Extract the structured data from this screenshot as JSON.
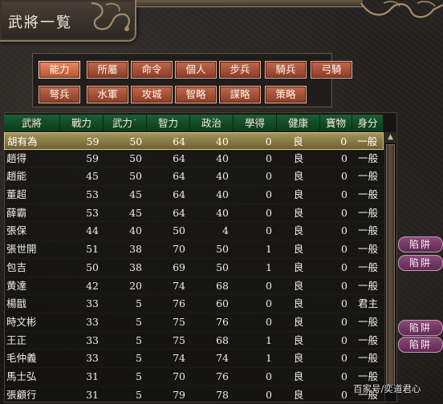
{
  "window": {
    "title": "武將一覧"
  },
  "category_buttons": [
    {
      "label": "能力",
      "active": true
    },
    {
      "label": "所屬",
      "active": false
    },
    {
      "label": "命令",
      "active": false
    },
    {
      "label": "個人",
      "active": false
    },
    {
      "label": "步兵",
      "active": false
    },
    {
      "label": "騎兵",
      "active": false
    },
    {
      "label": "弓騎",
      "active": false
    },
    {
      "label": "弩兵",
      "active": false
    },
    {
      "label": "水軍",
      "active": false
    },
    {
      "label": "攻城",
      "active": false
    },
    {
      "label": "智略",
      "active": false
    },
    {
      "label": "謀略",
      "active": false
    },
    {
      "label": "策略",
      "active": false
    }
  ],
  "table": {
    "headers": [
      "武將",
      "戰力",
      "武力",
      "智力",
      "政治",
      "學得",
      "健康",
      "寶物",
      "身分"
    ],
    "sorted_column": "武力",
    "rows": [
      {
        "name": "胡有為",
        "zhanli": "59",
        "wuli": "50",
        "zhili": "64",
        "zhengzhi": "40",
        "xuede": "0",
        "jiankang": "良",
        "baowu": "0",
        "shenfen": "一般",
        "selected": true
      },
      {
        "name": "趙得",
        "zhanli": "59",
        "wuli": "50",
        "zhili": "64",
        "zhengzhi": "40",
        "xuede": "0",
        "jiankang": "良",
        "baowu": "0",
        "shenfen": "一般"
      },
      {
        "name": "趙能",
        "zhanli": "45",
        "wuli": "50",
        "zhili": "64",
        "zhengzhi": "40",
        "xuede": "0",
        "jiankang": "良",
        "baowu": "0",
        "shenfen": "一般"
      },
      {
        "name": "董超",
        "zhanli": "53",
        "wuli": "45",
        "zhili": "64",
        "zhengzhi": "40",
        "xuede": "0",
        "jiankang": "良",
        "baowu": "0",
        "shenfen": "一般"
      },
      {
        "name": "薛霸",
        "zhanli": "53",
        "wuli": "45",
        "zhili": "64",
        "zhengzhi": "40",
        "xuede": "0",
        "jiankang": "良",
        "baowu": "0",
        "shenfen": "一般"
      },
      {
        "name": "張保",
        "zhanli": "44",
        "wuli": "40",
        "zhili": "50",
        "zhengzhi": "4",
        "xuede": "0",
        "jiankang": "良",
        "baowu": "0",
        "shenfen": "一般"
      },
      {
        "name": "張世開",
        "zhanli": "51",
        "wuli": "38",
        "zhili": "70",
        "zhengzhi": "50",
        "xuede": "1",
        "jiankang": "良",
        "baowu": "0",
        "shenfen": "一般"
      },
      {
        "name": "包吉",
        "zhanli": "50",
        "wuli": "38",
        "zhili": "69",
        "zhengzhi": "50",
        "xuede": "1",
        "jiankang": "良",
        "baowu": "0",
        "shenfen": "一般"
      },
      {
        "name": "黄達",
        "zhanli": "42",
        "wuli": "20",
        "zhili": "74",
        "zhengzhi": "68",
        "xuede": "0",
        "jiankang": "良",
        "baowu": "0",
        "shenfen": "一般"
      },
      {
        "name": "楊戩",
        "zhanli": "33",
        "wuli": "5",
        "zhili": "76",
        "zhengzhi": "60",
        "xuede": "0",
        "jiankang": "良",
        "baowu": "0",
        "shenfen": "君主"
      },
      {
        "name": "時文彬",
        "zhanli": "33",
        "wuli": "5",
        "zhili": "75",
        "zhengzhi": "76",
        "xuede": "0",
        "jiankang": "良",
        "baowu": "0",
        "shenfen": "一般"
      },
      {
        "name": "王正",
        "zhanli": "33",
        "wuli": "5",
        "zhili": "75",
        "zhengzhi": "68",
        "xuede": "1",
        "jiankang": "良",
        "baowu": "0",
        "shenfen": "一般"
      },
      {
        "name": "毛仲義",
        "zhanli": "33",
        "wuli": "5",
        "zhili": "74",
        "zhengzhi": "74",
        "xuede": "1",
        "jiankang": "良",
        "baowu": "0",
        "shenfen": "一般"
      },
      {
        "name": "馬士弘",
        "zhanli": "31",
        "wuli": "5",
        "zhili": "70",
        "zhengzhi": "76",
        "xuede": "0",
        "jiankang": "良",
        "baowu": "0",
        "shenfen": "一般"
      },
      {
        "name": "張顧行",
        "zhanli": "31",
        "wuli": "5",
        "zhili": "79",
        "zhengzhi": "78",
        "xuede": "0",
        "jiankang": "良",
        "baowu": "0",
        "shenfen": "一般"
      }
    ]
  },
  "side_tags": [
    {
      "label": "陷阱"
    },
    {
      "label": "陷阱"
    },
    {
      "label": "陷阱"
    },
    {
      "label": "陷阱"
    }
  ],
  "watermark": "百家号/奕道君心",
  "colors": {
    "header_green": "#1c5d34",
    "button_red": "#b8522f",
    "selected_row": "#a3945a",
    "tag_purple": "#8b4a7a"
  }
}
